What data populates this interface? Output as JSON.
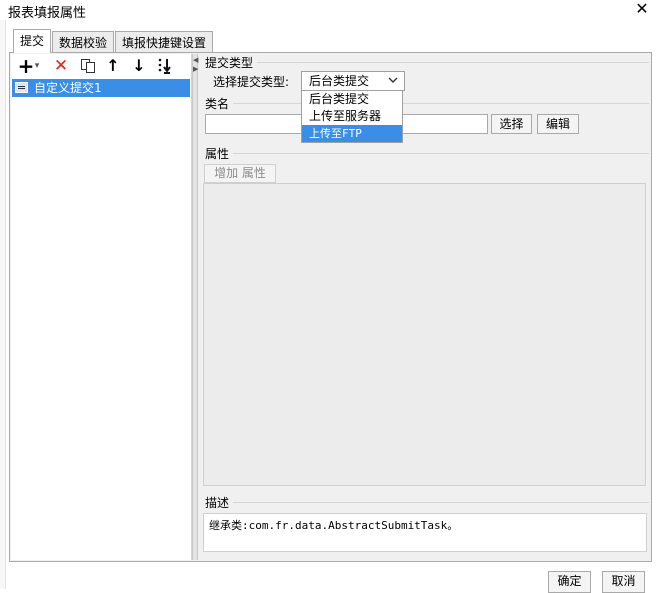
{
  "window": {
    "title": "报表填报属性",
    "close_glyph": "✕"
  },
  "tabs": [
    {
      "label": "提交",
      "active": true
    },
    {
      "label": "数据校验",
      "active": false
    },
    {
      "label": "填报快捷键设置",
      "active": false
    }
  ],
  "toolbar": {
    "add_icon": "plus-icon",
    "add_glyph": "+",
    "dropdown_glyph": "▾",
    "delete_icon": "delete-x-icon",
    "delete_glyph": "✕",
    "copy_icon": "copy-icon",
    "up_icon": "arrow-up-icon",
    "up_glyph": "↑",
    "down_icon": "arrow-down-icon",
    "down_glyph": "↓",
    "move_bottom_icon": "move-to-bottom-icon",
    "move_bottom_glyph": "⇊"
  },
  "list": {
    "items": [
      {
        "label": "自定义提交1",
        "selected": true
      }
    ]
  },
  "submit_type": {
    "section_label": "提交类型",
    "field_label": "选择提交类型:",
    "selected_value": "后台类提交",
    "options": [
      "后台类提交",
      "上传至服务器",
      "上传至FTP"
    ],
    "highlighted_option": "上传至FTP"
  },
  "class_name": {
    "section_label": "类名",
    "value": "",
    "select_button": "选择",
    "edit_button": "编辑"
  },
  "attributes": {
    "section_label": "属性",
    "add_button": "增加 属性"
  },
  "description": {
    "section_label": "描述",
    "text": "继承类:com.fr.data.AbstractSubmitTask。"
  },
  "footer": {
    "ok_button": "确定",
    "cancel_button": "取消"
  },
  "colors": {
    "selection": "#3a8ee6",
    "panel_bg": "#f0f0f0",
    "delete_red": "#e0241b"
  }
}
